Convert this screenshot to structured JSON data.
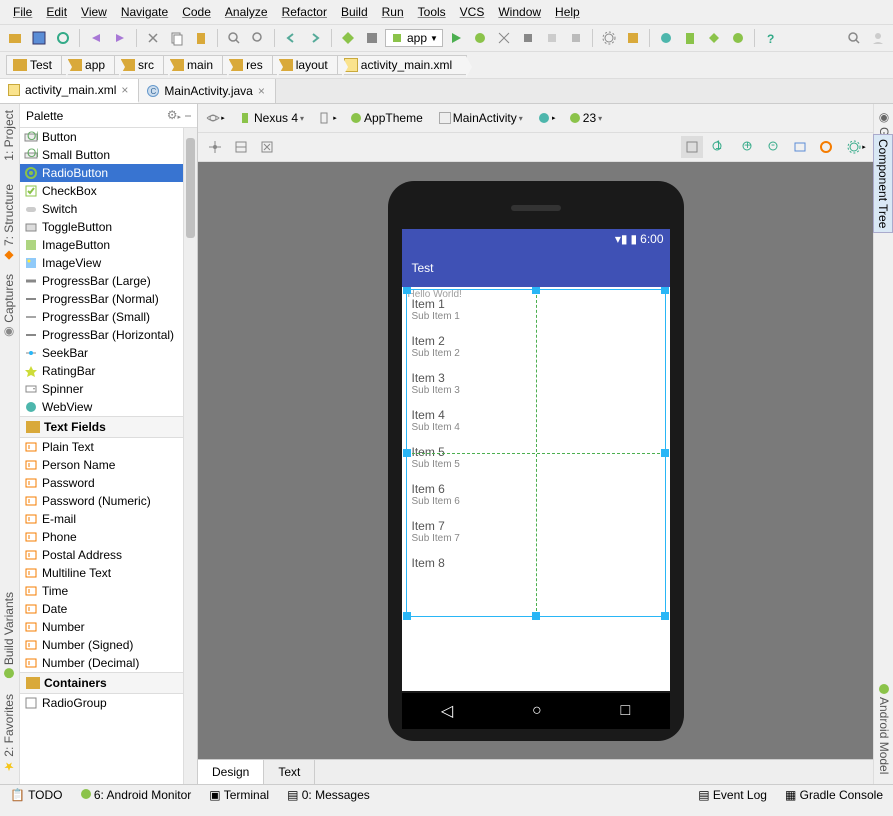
{
  "menu": [
    "File",
    "Edit",
    "View",
    "Navigate",
    "Code",
    "Analyze",
    "Refactor",
    "Build",
    "Run",
    "Tools",
    "VCS",
    "Window",
    "Help"
  ],
  "app_combo": "app",
  "breadcrumbs": [
    "Test",
    "app",
    "src",
    "main",
    "res",
    "layout",
    "activity_main.xml"
  ],
  "tabs": [
    {
      "label": "activity_main.xml",
      "icon": "xml",
      "close": true
    },
    {
      "label": "MainActivity.java",
      "icon": "java",
      "close": true
    }
  ],
  "active_tab": 0,
  "left_gutter": [
    "1: Project",
    "7: Structure",
    "Captures",
    "Build Variants",
    "2: Favorites"
  ],
  "right_gutter": [
    "Gradle",
    "Component Tree",
    "Android Model"
  ],
  "palette_title": "Palette",
  "palette_widgets": [
    "Button",
    "Small Button",
    "RadioButton",
    "CheckBox",
    "Switch",
    "ToggleButton",
    "ImageButton",
    "ImageView",
    "ProgressBar (Large)",
    "ProgressBar (Normal)",
    "ProgressBar (Small)",
    "ProgressBar (Horizontal)",
    "SeekBar",
    "RatingBar",
    "Spinner",
    "WebView"
  ],
  "palette_selected": "RadioButton",
  "textfields_cat": "Text Fields",
  "textfields": [
    "Plain Text",
    "Person Name",
    "Password",
    "Password (Numeric)",
    "E-mail",
    "Phone",
    "Postal Address",
    "Multiline Text",
    "Time",
    "Date",
    "Number",
    "Number (Signed)",
    "Number (Decimal)"
  ],
  "containers_cat": "Containers",
  "containers": [
    "RadioGroup"
  ],
  "design_toolbar": {
    "device": "Nexus 4",
    "theme": "AppTheme",
    "activity": "MainActivity",
    "api": "23"
  },
  "phone": {
    "time": "6:00",
    "app_title": "Test",
    "hello": "Hello World!"
  },
  "list_items": [
    {
      "t": "Item 1",
      "s": "Sub Item 1"
    },
    {
      "t": "Item 2",
      "s": "Sub Item 2"
    },
    {
      "t": "Item 3",
      "s": "Sub Item 3"
    },
    {
      "t": "Item 4",
      "s": "Sub Item 4"
    },
    {
      "t": "Item 5",
      "s": "Sub Item 5"
    },
    {
      "t": "Item 6",
      "s": "Sub Item 6"
    },
    {
      "t": "Item 7",
      "s": "Sub Item 7"
    },
    {
      "t": "Item 8",
      "s": ""
    }
  ],
  "bottom_tabs": [
    "Design",
    "Text"
  ],
  "status_bottom": {
    "todo": "TODO",
    "monitor": "6: Android Monitor",
    "terminal": "Terminal",
    "messages": "0: Messages",
    "eventlog": "Event Log",
    "gradle": "Gradle Console"
  }
}
